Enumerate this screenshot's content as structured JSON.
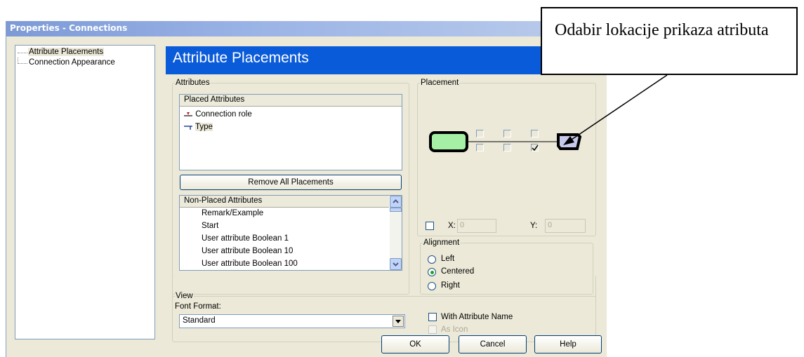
{
  "window": {
    "title": "Properties - Connections"
  },
  "tree": {
    "items": [
      {
        "label": "Attribute Placements",
        "selected": true
      },
      {
        "label": "Connection Appearance",
        "selected": false
      }
    ]
  },
  "page": {
    "header": "Attribute Placements"
  },
  "attributes": {
    "legend": "Attributes",
    "placed": {
      "header": "Placed Attributes",
      "items": [
        "Connection role",
        "Type"
      ]
    },
    "remove_all_label": "Remove All Placements",
    "non_placed": {
      "header": "Non-Placed Attributes",
      "items": [
        "Remark/Example",
        "Start",
        "User attribute Boolean 1",
        "User attribute Boolean 10",
        "User attribute Boolean 100"
      ]
    }
  },
  "placement": {
    "legend": "Placement",
    "x_label": "X:",
    "x_value": "0",
    "y_label": "Y:",
    "y_value": "0",
    "checked_slot": "bottom-right",
    "colors": {
      "source": "#a6f0a6",
      "target": "#c7c9ea"
    }
  },
  "alignment": {
    "legend": "Alignment",
    "options": [
      "Left",
      "Centered",
      "Right"
    ],
    "selected": "Centered"
  },
  "view": {
    "legend": "View",
    "font_format_label": "Font Format:",
    "font_format_value": "Standard",
    "with_attribute_name": "With Attribute Name",
    "as_icon": "As Icon"
  },
  "buttons": {
    "ok": "OK",
    "cancel": "Cancel",
    "help": "Help"
  },
  "callout": {
    "text": "Odabir lokacije prikaza atributa"
  }
}
